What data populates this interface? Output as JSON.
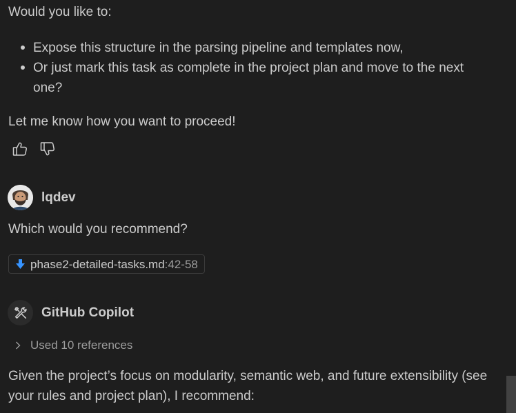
{
  "response1": {
    "intro": "Would you like to:",
    "options": [
      "Expose this structure in the parsing pipeline and templates now,",
      "Or just mark this task as complete in the project plan and move to the next one?"
    ],
    "closing": "Let me know how you want to proceed!"
  },
  "feedback": {
    "like_icon": "thumbs-up-icon",
    "dislike_icon": "thumbs-down-icon"
  },
  "user_message": {
    "username": "lqdev",
    "text": "Which would you recommend?",
    "attachment": {
      "icon": "arrow-down-icon",
      "filename": "phase2-detailed-tasks.md",
      "lines": ":42-58"
    }
  },
  "assistant": {
    "name": "GitHub Copilot",
    "icon": "tools-icon",
    "references_label": "Used 10 references",
    "response_line1": "Given the project’s focus on modularity, semantic web, and future extensibility (see",
    "response_line2": "your rules and project plan), I recommend:"
  },
  "colors": {
    "background": "#1e1e1e",
    "text": "#cccccc",
    "muted": "#9d9d9d",
    "accent_arrow": "#3794ff"
  }
}
